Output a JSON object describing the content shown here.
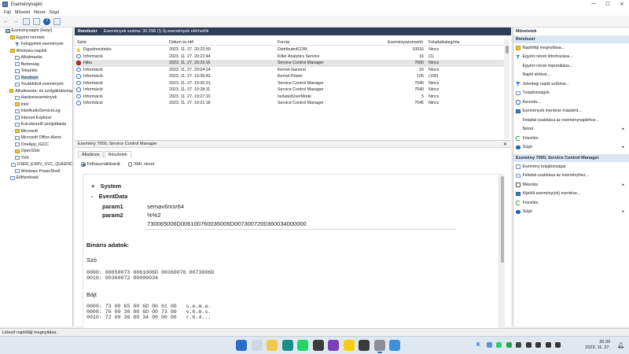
{
  "window": {
    "title": "Eseménynapló",
    "controls": [
      "—",
      "☐",
      "✕"
    ]
  },
  "menu": [
    "Fájl",
    "Művelet",
    "Nézet",
    "Súgó"
  ],
  "tree": [
    {
      "label": "Eseménynapló (Helyi)",
      "indent": 0,
      "twisty": "",
      "icon": "pc",
      "selected": false
    },
    {
      "label": "Egyéni nézetek",
      "indent": 1,
      "twisty": "⌄",
      "icon": "folder",
      "selected": false
    },
    {
      "label": "Felügyeleti események",
      "indent": 2,
      "twisty": "",
      "icon": "filter",
      "selected": false
    },
    {
      "label": "Windows-naplók",
      "indent": 1,
      "twisty": "⌄",
      "icon": "folder",
      "selected": false
    },
    {
      "label": "Alkalmazás",
      "indent": 2,
      "twisty": "",
      "icon": "log",
      "selected": false
    },
    {
      "label": "Biztonság",
      "indent": 2,
      "twisty": "",
      "icon": "log",
      "selected": false
    },
    {
      "label": "Telepítés",
      "indent": 2,
      "twisty": "",
      "icon": "log",
      "selected": false
    },
    {
      "label": "Rendszer",
      "indent": 2,
      "twisty": "",
      "icon": "log",
      "selected": true
    },
    {
      "label": "Továbbított események",
      "indent": 2,
      "twisty": "",
      "icon": "log",
      "selected": false
    },
    {
      "label": "Alkalmazás- és szolgáltatásnaplók",
      "indent": 1,
      "twisty": "⌄",
      "icon": "folder",
      "selected": false
    },
    {
      "label": "Hardveresemények",
      "indent": 2,
      "twisty": "",
      "icon": "log",
      "selected": false
    },
    {
      "label": "Intel",
      "indent": 2,
      "twisty": "›",
      "icon": "folder",
      "selected": false
    },
    {
      "label": "IntelAudioServiceLog",
      "indent": 2,
      "twisty": "",
      "icon": "log",
      "selected": false
    },
    {
      "label": "Internet Explorer",
      "indent": 2,
      "twisty": "",
      "icon": "log",
      "selected": false
    },
    {
      "label": "Kulcskezelő szolgáltatás",
      "indent": 2,
      "twisty": "",
      "icon": "log",
      "selected": false
    },
    {
      "label": "Microsoft",
      "indent": 2,
      "twisty": "›",
      "icon": "folder",
      "selected": false
    },
    {
      "label": "Microsoft Office Alerts",
      "indent": 2,
      "twisty": "",
      "icon": "log",
      "selected": false
    },
    {
      "label": "OneApp_IGCC",
      "indent": 2,
      "twisty": "",
      "icon": "log",
      "selected": false
    },
    {
      "label": "OpenSSH",
      "indent": 2,
      "twisty": "›",
      "icon": "folder",
      "selected": false
    },
    {
      "label": "THX",
      "indent": 2,
      "twisty": "",
      "icon": "log",
      "selected": false
    },
    {
      "label": "USER_ESRV_SVC_QUEENCREEK",
      "indent": 2,
      "twisty": "",
      "icon": "log",
      "selected": false
    },
    {
      "label": "Windows PowerShell",
      "indent": 2,
      "twisty": "",
      "icon": "log",
      "selected": false
    },
    {
      "label": "Előfizetések",
      "indent": 1,
      "twisty": "",
      "icon": "log",
      "selected": false
    }
  ],
  "list": {
    "title": "Rendszer",
    "count_text": "Események száma: 30 298 (!) Új események elérhetők",
    "columns": [
      "Szint",
      "Dátum és idő",
      "Forrás",
      "Eseményazonosító",
      "Feladatkategória"
    ],
    "rows": [
      {
        "level": "Figyelmeztetés",
        "type": "warn",
        "date": "2023. 11. 27. 20:22:50",
        "source": "DistributedCOM",
        "id": "10016",
        "task": "Nincs",
        "selected": false
      },
      {
        "level": "Információ",
        "type": "info",
        "date": "2023. 11. 27. 20:22:44",
        "source": "Killer Analytics Service",
        "id": "16",
        "task": "(1)",
        "selected": false
      },
      {
        "level": "Hiba",
        "type": "err",
        "date": "2023. 11. 27. 20:22:16",
        "source": "Service Control Manager",
        "id": "7000",
        "task": "Nincs",
        "selected": true
      },
      {
        "level": "Információ",
        "type": "info",
        "date": "2023. 11. 27. 20:04:24",
        "source": "Kernel-General",
        "id": "16",
        "task": "Nincs",
        "selected": false
      },
      {
        "level": "Információ",
        "type": "info",
        "date": "2023. 11. 27. 19:36:42",
        "source": "Kernel-Power",
        "id": "105",
        "task": "(100)",
        "selected": false
      },
      {
        "level": "Információ",
        "type": "info",
        "date": "2023. 11. 27. 19:30:31",
        "source": "Service Control Manager",
        "id": "7040",
        "task": "Nincs",
        "selected": false
      },
      {
        "level": "Információ",
        "type": "info",
        "date": "2023. 11. 27. 19:28:11",
        "source": "Service Control Manager",
        "id": "7040",
        "task": "Nincs",
        "selected": false
      },
      {
        "level": "Információ",
        "type": "info",
        "date": "2023. 11. 27. 19:27:10",
        "source": "IsolatedUserMode",
        "id": "5",
        "task": "Nincs",
        "selected": false
      },
      {
        "level": "Információ",
        "type": "info",
        "date": "2023. 11. 27. 19:21:18",
        "source": "Service Control Manager",
        "id": "7045",
        "task": "Nincs",
        "selected": false
      }
    ]
  },
  "detail": {
    "title": "Esemény 7000, Service Control Manager",
    "close": "✕",
    "tabs": [
      "Általános",
      "Részletek"
    ],
    "active_tab": 1,
    "view_friendly": "Felhasználóbarát",
    "view_xml": "XML nézet",
    "system_label": "System",
    "system_toggle": "+",
    "eventdata_label": "EventData",
    "eventdata_toggle": "-",
    "param1_label": "param1",
    "param1_value": "semav6msr64",
    "param2_label": "param2",
    "param2_value": "%%2",
    "binary_line": "730065006D006100760036006D0073007200360034000000",
    "binary_title": "Bináris adatok:",
    "words_title": "Szó",
    "words_text": "0000: 00650073 0061006D 00360076 0073006D\n0010: 00360072 00000034",
    "bytes_title": "Bájt",
    "bytes_text": "0000: 73 00 65 00 6D 00 61 00   s.e.m.a.\n0008: 76 00 36 00 6D 00 73 00   v.6.m.s.\n0010: 72 00 36 00 34 00 00 00   r.6.4..."
  },
  "actions": {
    "title": "Műveletek",
    "section1": "Rendszer",
    "items1": [
      {
        "label": "Naplófájl megnyitása...",
        "icon": "a-folder",
        "arrow": ""
      },
      {
        "label": "Egyéni nézet létrehozása...",
        "icon": "a-filter",
        "arrow": ""
      },
      {
        "label": "Egyéni nézet importálása...",
        "icon": "a-none",
        "arrow": ""
      },
      {
        "label": "Napló törlése...",
        "icon": "a-none",
        "arrow": ""
      },
      {
        "label": "Jelenlegi napló szűrése...",
        "icon": "a-filter",
        "arrow": ""
      },
      {
        "label": "Tulajdonságok",
        "icon": "a-doc",
        "arrow": ""
      },
      {
        "label": "Keresés...",
        "icon": "a-search",
        "arrow": ""
      },
      {
        "label": "Események mentése másként...",
        "icon": "a-save",
        "arrow": ""
      },
      {
        "label": "Feladat csatolása az eseménynaplóhoz...",
        "icon": "a-none",
        "arrow": ""
      },
      {
        "label": "Nézet",
        "icon": "a-none",
        "arrow": "▸"
      },
      {
        "label": "Frissítés",
        "icon": "a-refresh",
        "arrow": ""
      },
      {
        "label": "Súgó",
        "icon": "a-help",
        "arrow": "▸"
      }
    ],
    "section2": "Esemény 7000, Service Control Manager",
    "items2": [
      {
        "label": "Esemény tulajdonságai",
        "icon": "a-doc",
        "arrow": ""
      },
      {
        "label": "Feladat csatolása az eseményhez...",
        "icon": "a-view",
        "arrow": ""
      },
      {
        "label": "Másolás",
        "icon": "a-copy",
        "arrow": "▸"
      },
      {
        "label": "Kijelölt esemény(ek) mentése...",
        "icon": "a-save",
        "arrow": ""
      },
      {
        "label": "Frissítés",
        "icon": "a-refresh",
        "arrow": ""
      },
      {
        "label": "Súgó",
        "icon": "a-help",
        "arrow": "▸"
      }
    ]
  },
  "status": "Létező naplófájl megnyitása.",
  "taskbar": {
    "apps": [
      {
        "name": "start",
        "color": "#2b6cc4",
        "active": false
      },
      {
        "name": "search",
        "color": "#cfd8e2",
        "active": false
      },
      {
        "name": "file-explorer",
        "color": "#f2c94c",
        "active": false
      },
      {
        "name": "edge",
        "color": "#1a8f8a",
        "active": false
      },
      {
        "name": "whatsapp",
        "color": "#25d366",
        "active": false
      },
      {
        "name": "app-dark",
        "color": "#3b3b3b",
        "active": false
      },
      {
        "name": "onenote",
        "color": "#7b3fb8",
        "active": false
      },
      {
        "name": "sticky-notes",
        "color": "#f5d000",
        "active": false
      },
      {
        "name": "terminal",
        "color": "#3a3a3a",
        "active": false
      },
      {
        "name": "event-viewer",
        "color": "#8a8f98",
        "active": true
      },
      {
        "name": "chrome",
        "color": "#3e8fd8",
        "active": false
      }
    ],
    "tray": [
      {
        "name": "k-app",
        "color": "#2a6fb8",
        "glyph": "K"
      },
      {
        "name": "security",
        "color": "#5b8fd8",
        "glyph": ""
      },
      {
        "name": "whatsapp-tray",
        "color": "#25d366",
        "glyph": ""
      },
      {
        "name": "green-app",
        "color": "#1fa84f",
        "glyph": ""
      },
      {
        "name": "dark-app",
        "color": "#444",
        "glyph": ""
      },
      {
        "name": "network",
        "color": "#333",
        "glyph": ""
      },
      {
        "name": "wifi",
        "color": "#333",
        "glyph": ""
      },
      {
        "name": "speaker",
        "color": "#333",
        "glyph": ""
      },
      {
        "name": "battery",
        "color": "#333",
        "glyph": ""
      }
    ],
    "time": "20:39",
    "date": "2023. 11. 27."
  }
}
